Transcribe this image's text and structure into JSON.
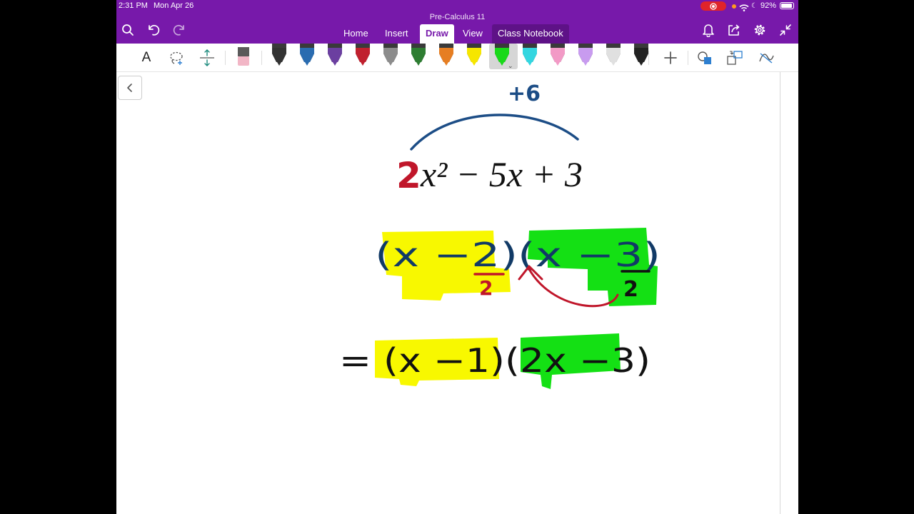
{
  "status_bar": {
    "time": "2:31 PM",
    "date": "Mon Apr 26",
    "battery": "92%"
  },
  "app": {
    "document_title": "Pre-Calculus 11"
  },
  "tabs": [
    {
      "label": "Home"
    },
    {
      "label": "Insert"
    },
    {
      "label": "Draw"
    },
    {
      "label": "View"
    },
    {
      "label": "Class Notebook"
    }
  ],
  "ribbon": {
    "type_tool_label": "A",
    "pens": [
      {
        "color": "#333333"
      },
      {
        "color": "#2a6cb0"
      },
      {
        "color": "#6b3fa0"
      },
      {
        "color": "#c0202e"
      },
      {
        "color": "#8c8c8c"
      },
      {
        "color": "#2e7d32"
      },
      {
        "color": "#e67e22"
      },
      {
        "color": "#f6e600"
      },
      {
        "color": "#19d919"
      },
      {
        "color": "#33d6e0"
      },
      {
        "color": "#f29ac6"
      },
      {
        "color": "#c89bef"
      },
      {
        "color": "#e0e0e0"
      },
      {
        "color": "#222222"
      }
    ],
    "selected_pen_index": 8
  },
  "note": {
    "top_label": "+6",
    "expression_coeff": "2",
    "expression_rest": "x² − 5x + 3",
    "factor_line_1": "(x  −2)(x  −3)",
    "factor_line_1_divisors": [
      "2",
      "2"
    ],
    "factor_line_2": "= (x  −1)(2x  −3)"
  },
  "colors": {
    "accent": "#7719AA",
    "ink_blue": "#1c4d86",
    "ink_red": "#c0162a",
    "ink_black": "#111111",
    "highlight_yellow": "#f8f800",
    "highlight_green": "#14e014"
  }
}
